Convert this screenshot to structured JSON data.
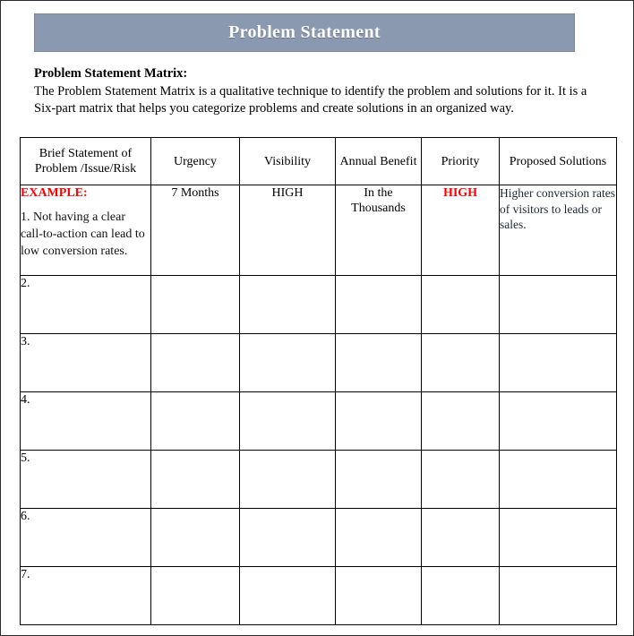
{
  "banner": {
    "title": "Problem Statement",
    "background_color": "#8b99b0",
    "text_color": "#ffffff"
  },
  "intro": {
    "heading": "Problem Statement Matrix:",
    "body": "The Problem Statement Matrix is a qualitative technique to identify the problem and solutions for it. It is a Six-part matrix that helps you categorize problems and create solutions in an organized way."
  },
  "table": {
    "headers": {
      "problem": "Brief Statement of Problem /Issue/Risk",
      "urgency": "Urgency",
      "visibility": "Visibility",
      "benefit": "Annual Benefit",
      "priority": "Priority",
      "solutions": "Proposed Solutions"
    },
    "example_row": {
      "label": "EXAMPLE:",
      "label_color": "#ff0000",
      "problem": "1. Not having a clear call-to-action can lead to low conversion rates.",
      "urgency": "7 Months",
      "visibility": "HIGH",
      "benefit": "In the Thousands",
      "priority": "HIGH",
      "priority_color": "#ff0000",
      "solutions": "Higher conversion rates of visitors to leads or sales."
    },
    "blank_rows": [
      {
        "number": "2.",
        "problem": "",
        "urgency": "",
        "visibility": "",
        "benefit": "",
        "priority": "",
        "solutions": ""
      },
      {
        "number": "3.",
        "problem": "",
        "urgency": "",
        "visibility": "",
        "benefit": "",
        "priority": "",
        "solutions": ""
      },
      {
        "number": "4.",
        "problem": "",
        "urgency": "",
        "visibility": "",
        "benefit": "",
        "priority": "",
        "solutions": ""
      },
      {
        "number": "5.",
        "problem": "",
        "urgency": "",
        "visibility": "",
        "benefit": "",
        "priority": "",
        "solutions": ""
      },
      {
        "number": "6.",
        "problem": "",
        "urgency": "",
        "visibility": "",
        "benefit": "",
        "priority": "",
        "solutions": ""
      },
      {
        "number": "7.",
        "problem": "",
        "urgency": "",
        "visibility": "",
        "benefit": "",
        "priority": "",
        "solutions": ""
      }
    ]
  }
}
